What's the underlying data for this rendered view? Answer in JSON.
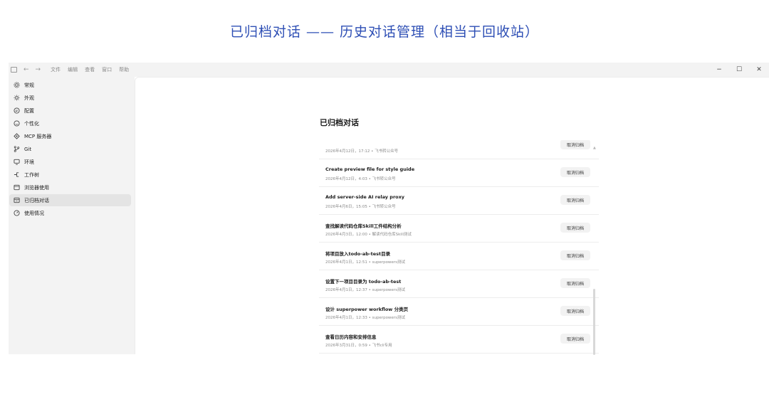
{
  "caption": "已归档对话 —— 历史对话管理（相当于回收站）",
  "menubar": {
    "sidebar_icon": "sidebar-toggle-icon",
    "back_arrow": "←",
    "forward_arrow": "→",
    "items": [
      "文件",
      "编辑",
      "查看",
      "窗口",
      "帮助"
    ],
    "window_controls": {
      "minimize": "−",
      "maximize": "☐",
      "close": "✕"
    }
  },
  "sidebar": {
    "items": [
      {
        "icon": "gear-icon",
        "label": "常规"
      },
      {
        "icon": "sun-icon",
        "label": "外观"
      },
      {
        "icon": "sliders-icon",
        "label": "配置"
      },
      {
        "icon": "smile-icon",
        "label": "个性化"
      },
      {
        "icon": "server-icon",
        "label": "MCP 服务器"
      },
      {
        "icon": "git-icon",
        "label": "Git"
      },
      {
        "icon": "monitor-icon",
        "label": "环境"
      },
      {
        "icon": "tree-icon",
        "label": "工作树"
      },
      {
        "icon": "browser-icon",
        "label": "浏览器使用"
      },
      {
        "icon": "archive-icon",
        "label": "已归档对话"
      },
      {
        "icon": "gauge-icon",
        "label": "使用情况"
      }
    ],
    "active_index": 9
  },
  "main": {
    "title": "已归档对话",
    "unarchive_label": "取消归档",
    "rows": [
      {
        "title": "",
        "meta": "2026年4月12日，17:12 • 飞书转公众号"
      },
      {
        "title": "Create preview file for style guide",
        "meta": "2026年4月12日，4:03 • 飞书转公众号"
      },
      {
        "title": "Add server-side AI relay proxy",
        "meta": "2026年4月6日，15:05 • 飞书转公众号"
      },
      {
        "title": "查找解读代码仓库Skill工件结构分析",
        "meta": "2026年4月3日，12:00 • 解读代码仓库Skill测试"
      },
      {
        "title": "将项目放入todo-ab-test目录",
        "meta": "2026年4月1日，12:51 • superpowers测试"
      },
      {
        "title": "设置下一项目目录为 todo-ab-test",
        "meta": "2026年4月1日，12:37 • superpowers测试"
      },
      {
        "title": "设计 superpower workflow 分类页",
        "meta": "2026年4月1日，12:33 • superpowers测试"
      },
      {
        "title": "查看日历内容和安排信息",
        "meta": "2026年3月31日，0:59 • 飞书cli专用"
      }
    ]
  },
  "colors": {
    "caption": "#2e4fb5",
    "sidebar_bg": "#f3f3f3",
    "active_item": "#e4e4e4",
    "button_bg": "#f2f2f2"
  }
}
